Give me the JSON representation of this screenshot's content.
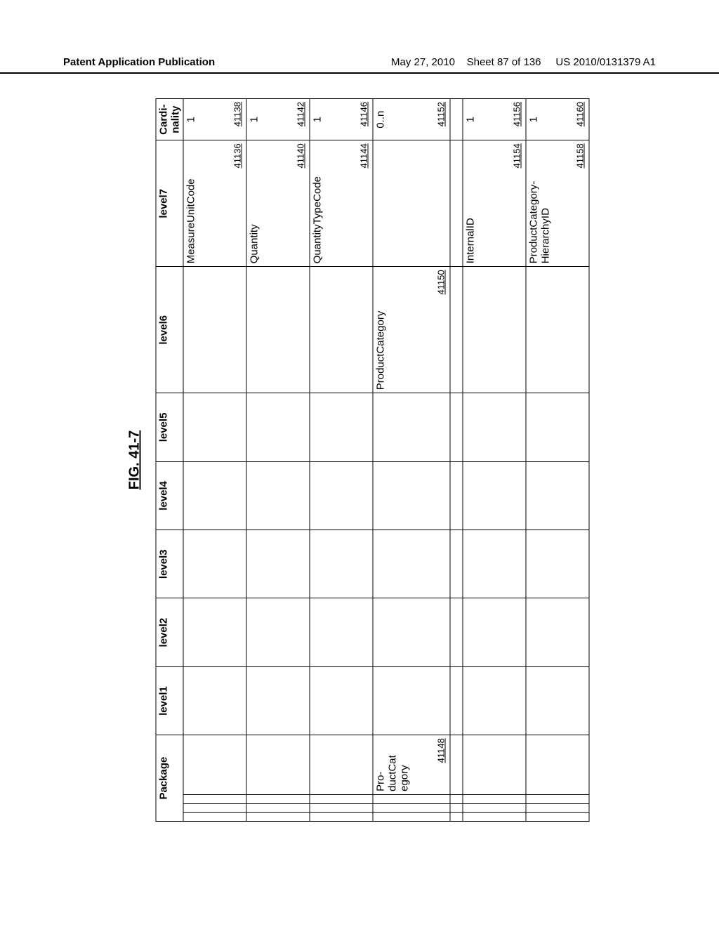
{
  "header": {
    "left": "Patent Application Publication",
    "date": "May 27, 2010",
    "sheet": "Sheet 87 of 136",
    "pubno": "US 2010/0131379 A1"
  },
  "figure": {
    "title": "FIG. 41-7"
  },
  "table": {
    "headers": {
      "package": "Package",
      "level1": "level1",
      "level2": "level2",
      "level3": "level3",
      "level4": "level4",
      "level5": "level5",
      "level6": "level6",
      "level7": "level7",
      "cardinality": "Cardi-\nnality"
    },
    "rows": [
      {
        "package": "",
        "level6": "",
        "level6_ref": "",
        "level7": "MeasureUnitCode",
        "level7_ref": "41136",
        "cardinality": "1",
        "cardinality_ref": "41138"
      },
      {
        "package": "",
        "level6": "",
        "level6_ref": "",
        "level7": "Quantity",
        "level7_ref": "41140",
        "cardinality": "1",
        "cardinality_ref": "41142"
      },
      {
        "package": "",
        "level6": "",
        "level6_ref": "",
        "level7": "QuantityTypeCode",
        "level7_ref": "41144",
        "cardinality": "1",
        "cardinality_ref": "41146"
      },
      {
        "package": "Pro-\nductCat\negory",
        "package_ref": "41148",
        "level6": "ProductCategory",
        "level6_ref": "41150",
        "level7": "",
        "level7_ref": "",
        "cardinality": "0..n",
        "cardinality_ref": "41152"
      },
      {
        "package": "",
        "level6": "",
        "level6_ref": "",
        "level7": "InternalID",
        "level7_ref": "41154",
        "cardinality": "1",
        "cardinality_ref": "41156"
      },
      {
        "package": "",
        "level6": "",
        "level6_ref": "",
        "level7": "ProductCategory-\nHierarchyID",
        "level7_ref": "41158",
        "cardinality": "1",
        "cardinality_ref": "41160"
      }
    ]
  }
}
